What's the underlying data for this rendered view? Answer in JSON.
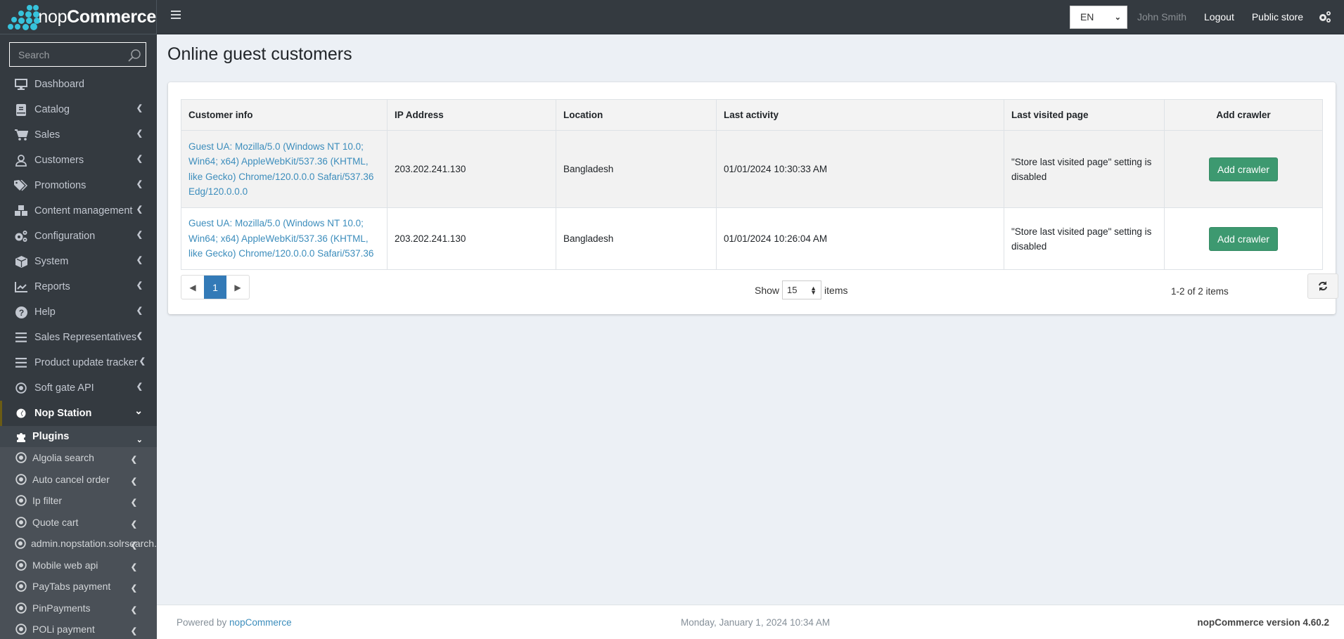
{
  "brand": {
    "name_light": "nop",
    "name_bold": "Commerce",
    "dot_color": "#37c3dc"
  },
  "topbar": {
    "language": "EN",
    "user_name": "John Smith",
    "logout_label": "Logout",
    "public_store_label": "Public store"
  },
  "sidebar": {
    "search_placeholder": "Search",
    "items": [
      {
        "label": "Dashboard",
        "icon": "monitor-icon",
        "has_arrow": false
      },
      {
        "label": "Catalog",
        "icon": "book-icon",
        "has_arrow": true
      },
      {
        "label": "Sales",
        "icon": "cart-icon",
        "has_arrow": true
      },
      {
        "label": "Customers",
        "icon": "user-icon",
        "has_arrow": true
      },
      {
        "label": "Promotions",
        "icon": "tags-icon",
        "has_arrow": true
      },
      {
        "label": "Content management",
        "icon": "cubes-icon",
        "has_arrow": true
      },
      {
        "label": "Configuration",
        "icon": "gears-icon",
        "has_arrow": true
      },
      {
        "label": "System",
        "icon": "cube-icon",
        "has_arrow": true
      },
      {
        "label": "Reports",
        "icon": "chart-line-icon",
        "has_arrow": true
      },
      {
        "label": "Help",
        "icon": "question-circle-icon",
        "has_arrow": true
      },
      {
        "label": "Sales Representatives",
        "icon": "list-icon",
        "has_arrow": true
      },
      {
        "label": "Product update tracker",
        "icon": "list-icon",
        "has_arrow": true
      },
      {
        "label": "Soft gate API",
        "icon": "dot-circle-icon",
        "has_arrow": true
      },
      {
        "label": "Nop Station",
        "icon": "nopstation-icon",
        "has_arrow": true,
        "expanded": true
      }
    ],
    "plugins_header": "Plugins",
    "plugins": [
      "Algolia search",
      "Auto cancel order",
      "Ip filter",
      "Quote cart",
      "admin.nopstation.solrsearch.",
      "Mobile web api",
      "PayTabs payment",
      "PinPayments",
      "POLi payment"
    ]
  },
  "main": {
    "title": "Online guest customers",
    "table": {
      "columns": [
        "Customer info",
        "IP Address",
        "Location",
        "Last activity",
        "Last visited page",
        "Add crawler"
      ],
      "rows": [
        {
          "customer_info": "Guest UA: Mozilla/5.0 (Windows NT 10.0; Win64; x64) AppleWebKit/537.36 (KHTML, like Gecko) Chrome/120.0.0.0 Safari/537.36 Edg/120.0.0.0",
          "ip": "203.202.241.130",
          "location": "Bangladesh",
          "last_activity": "01/01/2024 10:30:33 AM",
          "last_visited_page": "\"Store last visited page\" setting is disabled",
          "action_label": "Add crawler"
        },
        {
          "customer_info": "Guest UA: Mozilla/5.0 (Windows NT 10.0; Win64; x64) AppleWebKit/537.36 (KHTML, like Gecko) Chrome/120.0.0.0 Safari/537.36",
          "ip": "203.202.241.130",
          "location": "Bangladesh",
          "last_activity": "01/01/2024 10:26:04 AM",
          "last_visited_page": "\"Store last visited page\" setting is disabled",
          "action_label": "Add crawler"
        }
      ]
    },
    "pager": {
      "current_page": "1",
      "show_label": "Show",
      "page_size": "15",
      "items_label": "items",
      "info": "1-2 of 2 items"
    }
  },
  "footer": {
    "powered_by": "Powered by ",
    "powered_link": "nopCommerce",
    "datetime": "Monday, January 1, 2024 10:34 AM",
    "version": "nopCommerce version 4.60.2"
  }
}
